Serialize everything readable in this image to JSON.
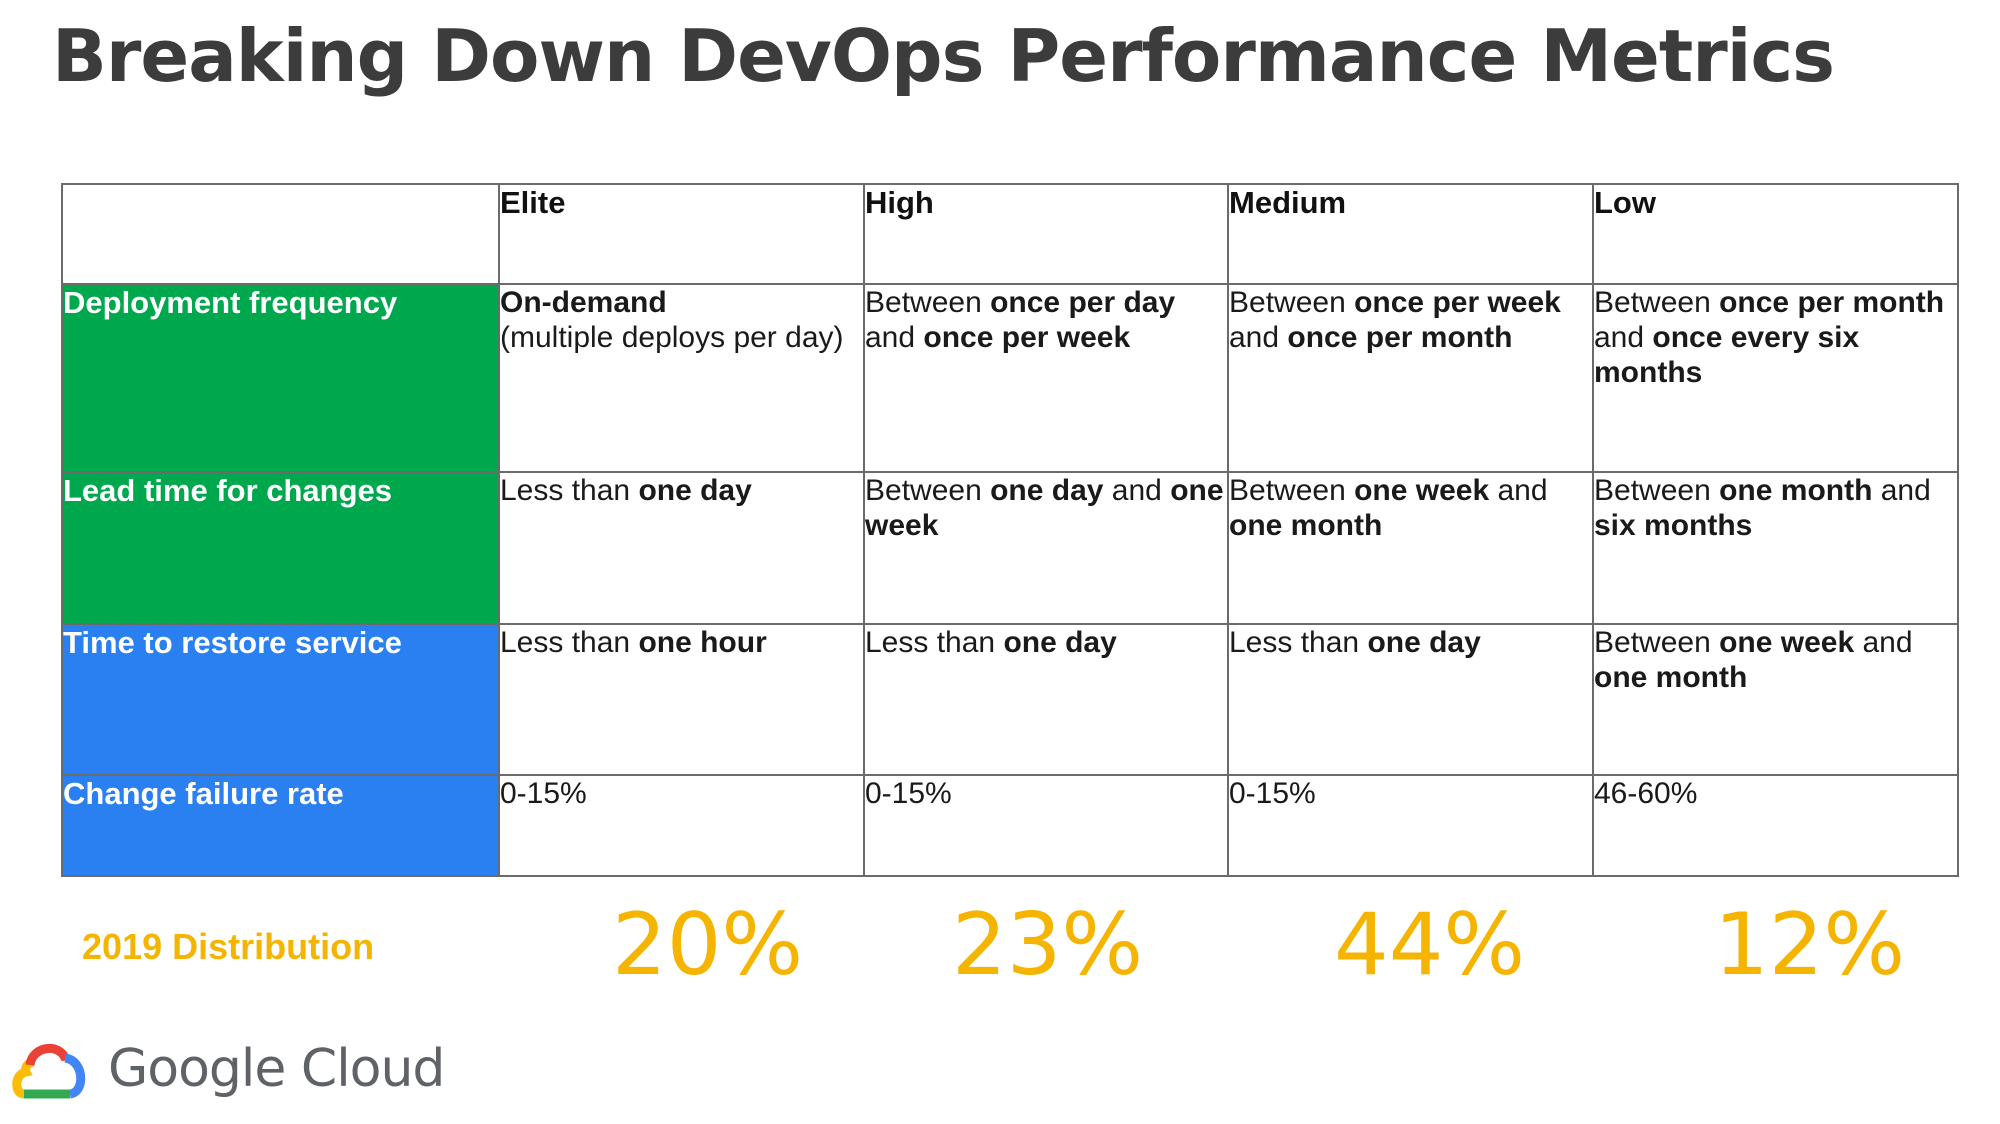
{
  "title": "Breaking Down DevOps Performance Metrics",
  "table": {
    "columns": [
      "",
      "Elite",
      "High",
      "Medium",
      "Low"
    ],
    "rows": [
      {
        "metric": "Deployment frequency",
        "category_color": "#00a84d",
        "cells": [
          [
            {
              "t": "On-demand",
              "b": true
            },
            {
              "t": "\n(multiple deploys per day)",
              "b": false
            }
          ],
          [
            {
              "t": "Between ",
              "b": false
            },
            {
              "t": "once per day",
              "b": true
            },
            {
              "t": " and ",
              "b": false
            },
            {
              "t": "once per week",
              "b": true
            }
          ],
          [
            {
              "t": "Between ",
              "b": false
            },
            {
              "t": "once per week",
              "b": true
            },
            {
              "t": " and ",
              "b": false
            },
            {
              "t": "once per month",
              "b": true
            }
          ],
          [
            {
              "t": "Between ",
              "b": false
            },
            {
              "t": "once per month",
              "b": true
            },
            {
              "t": " and ",
              "b": false
            },
            {
              "t": "once every six months",
              "b": true
            }
          ]
        ]
      },
      {
        "metric": "Lead time for changes",
        "category_color": "#00a84d",
        "cells": [
          [
            {
              "t": "Less than ",
              "b": false
            },
            {
              "t": "one day",
              "b": true
            }
          ],
          [
            {
              "t": "Between ",
              "b": false
            },
            {
              "t": "one day",
              "b": true
            },
            {
              "t": " and ",
              "b": false
            },
            {
              "t": "one week",
              "b": true
            }
          ],
          [
            {
              "t": "Between ",
              "b": false
            },
            {
              "t": "one week",
              "b": true
            },
            {
              "t": " and ",
              "b": false
            },
            {
              "t": "one month",
              "b": true
            }
          ],
          [
            {
              "t": "Between ",
              "b": false
            },
            {
              "t": "one month",
              "b": true
            },
            {
              "t": " and ",
              "b": false
            },
            {
              "t": "six months",
              "b": true
            }
          ]
        ]
      },
      {
        "metric": "Time to restore service",
        "category_color": "#2a80f0",
        "cells": [
          [
            {
              "t": "Less than ",
              "b": false
            },
            {
              "t": "one hour",
              "b": true
            }
          ],
          [
            {
              "t": "Less than ",
              "b": false
            },
            {
              "t": "one day",
              "b": true
            }
          ],
          [
            {
              "t": "Less than ",
              "b": false
            },
            {
              "t": "one day",
              "b": true
            }
          ],
          [
            {
              "t": "Between ",
              "b": false
            },
            {
              "t": "one week",
              "b": true
            },
            {
              "t": " and ",
              "b": false
            },
            {
              "t": "one month",
              "b": true
            }
          ]
        ]
      },
      {
        "metric": "Change failure rate",
        "category_color": "#2a80f0",
        "cells": [
          [
            {
              "t": "0-15%",
              "b": false
            }
          ],
          [
            {
              "t": "0-15%",
              "b": false
            }
          ],
          [
            {
              "t": "0-15%",
              "b": false
            }
          ],
          [
            {
              "t": "46-60%",
              "b": false
            }
          ]
        ]
      }
    ]
  },
  "distribution": {
    "label": "2019 Distribution",
    "color": "#f5b400",
    "values": [
      "20%",
      "23%",
      "44%",
      "12%"
    ]
  },
  "logo": {
    "text": "Google Cloud",
    "icon": "google-cloud-icon"
  }
}
